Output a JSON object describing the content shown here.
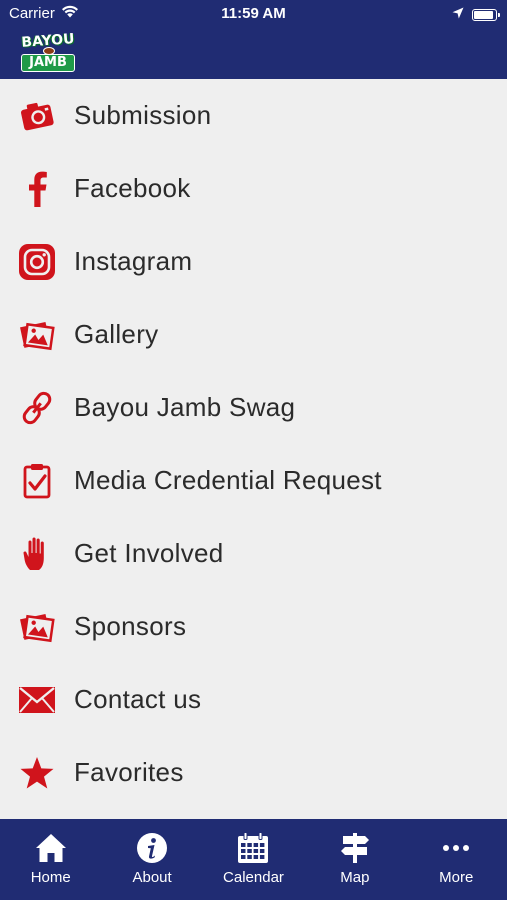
{
  "status_bar": {
    "carrier": "Carrier",
    "time": "11:59 AM"
  },
  "app": {
    "logo_top": "BAYOU",
    "logo_bottom": "JAMB"
  },
  "colors": {
    "nav_background": "#202c73",
    "icon_red": "#d0141c",
    "list_background": "#efefef",
    "text": "#2b2b2b"
  },
  "menu": {
    "items": [
      {
        "label": "Submission",
        "icon": "camera-icon"
      },
      {
        "label": "Facebook",
        "icon": "facebook-icon"
      },
      {
        "label": "Instagram",
        "icon": "instagram-icon"
      },
      {
        "label": "Gallery",
        "icon": "gallery-icon"
      },
      {
        "label": "Bayou Jamb Swag",
        "icon": "link-icon"
      },
      {
        "label": "Media Credential Request",
        "icon": "clipboard-check-icon"
      },
      {
        "label": "Get Involved",
        "icon": "hand-icon"
      },
      {
        "label": "Sponsors",
        "icon": "gallery-icon"
      },
      {
        "label": "Contact us",
        "icon": "envelope-icon"
      },
      {
        "label": "Favorites",
        "icon": "star-icon"
      }
    ]
  },
  "tabs": [
    {
      "label": "Home",
      "icon": "home-icon"
    },
    {
      "label": "About",
      "icon": "info-icon"
    },
    {
      "label": "Calendar",
      "icon": "calendar-icon"
    },
    {
      "label": "Map",
      "icon": "signpost-icon"
    },
    {
      "label": "More",
      "icon": "more-icon"
    }
  ]
}
